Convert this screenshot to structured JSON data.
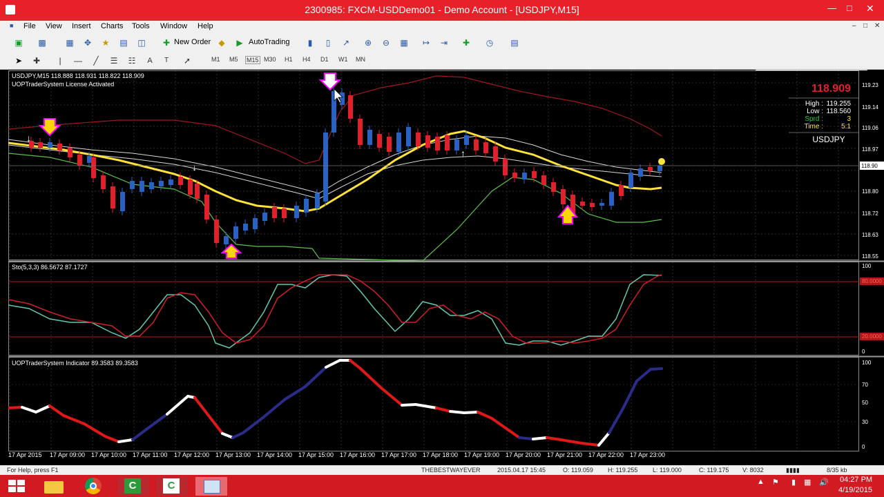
{
  "window": {
    "title": "2300985: FXCM-USDDemo01 - Demo Account - [USDJPY,M15]"
  },
  "menu": {
    "items": [
      "File",
      "View",
      "Insert",
      "Charts",
      "Tools",
      "Window",
      "Help"
    ]
  },
  "toolbar": {
    "new_order_label": "New Order",
    "autotrading_label": "AutoTrading"
  },
  "timeframes": [
    "M1",
    "M5",
    "M15",
    "M30",
    "H1",
    "H4",
    "D1",
    "W1",
    "MN"
  ],
  "chart": {
    "header": "USDJPY,M15  118.888 118.931 118.822 118.909",
    "license": "UOPTraderSystem License Activated",
    "price_big": "118.909",
    "info_high_label": "High :",
    "info_high_value": "119.255",
    "info_low_label": "Low :",
    "info_low_value": "118.560",
    "info_sprd_label": "Sprd :",
    "info_sprd_value": "3",
    "info_time_label": "Time :",
    "info_time_value": "5:1",
    "symbol_label": "USDJPY",
    "price_axis": [
      "119.23",
      "119.14",
      "119.06",
      "118.97",
      "118.90",
      "118.80",
      "118.72",
      "118.63",
      "118.55"
    ],
    "current_price_tag": "118.90"
  },
  "stoch": {
    "header": "Sto(5,3,3) 86.5672 87.1727",
    "axis": [
      "100",
      "80.0000",
      "20.0000",
      "0"
    ]
  },
  "uop": {
    "header": "UOPTraderSystem Indicator 89.3583 89.3583",
    "axis": [
      "100",
      "70",
      "50",
      "30",
      "0"
    ]
  },
  "dates": [
    "17 Apr 2015",
    "17 Apr 09:00",
    "17 Apr 10:00",
    "17 Apr 11:00",
    "17 Apr 12:00",
    "17 Apr 13:00",
    "17 Apr 14:00",
    "17 Apr 15:00",
    "17 Apr 16:00",
    "17 Apr 17:00",
    "17 Apr 18:00",
    "17 Apr 19:00",
    "17 Apr 20:00",
    "17 Apr 21:00",
    "17 Apr 22:00",
    "17 Apr 23:00"
  ],
  "status": {
    "help": "For Help, press F1",
    "profile": "THEBESTWAYEVER",
    "datetime": "2015.04.17 15:45",
    "open": "O: 119.059",
    "high": "H: 119.255",
    "low": "L: 119.000",
    "close": "C: 119.175",
    "volume": "V: 8032",
    "traffic": "8/35 kb"
  },
  "taskbar": {
    "time": "04:27 PM",
    "date": "4/19/2015"
  },
  "colors": {
    "bull": "#2a62c4",
    "bear": "#e0202a",
    "ma_yellow": "#ffe23a",
    "stoch_main": "#63c8b0",
    "stoch_signal": "#d0202a",
    "uop_bull": "#2b2b8a"
  }
}
